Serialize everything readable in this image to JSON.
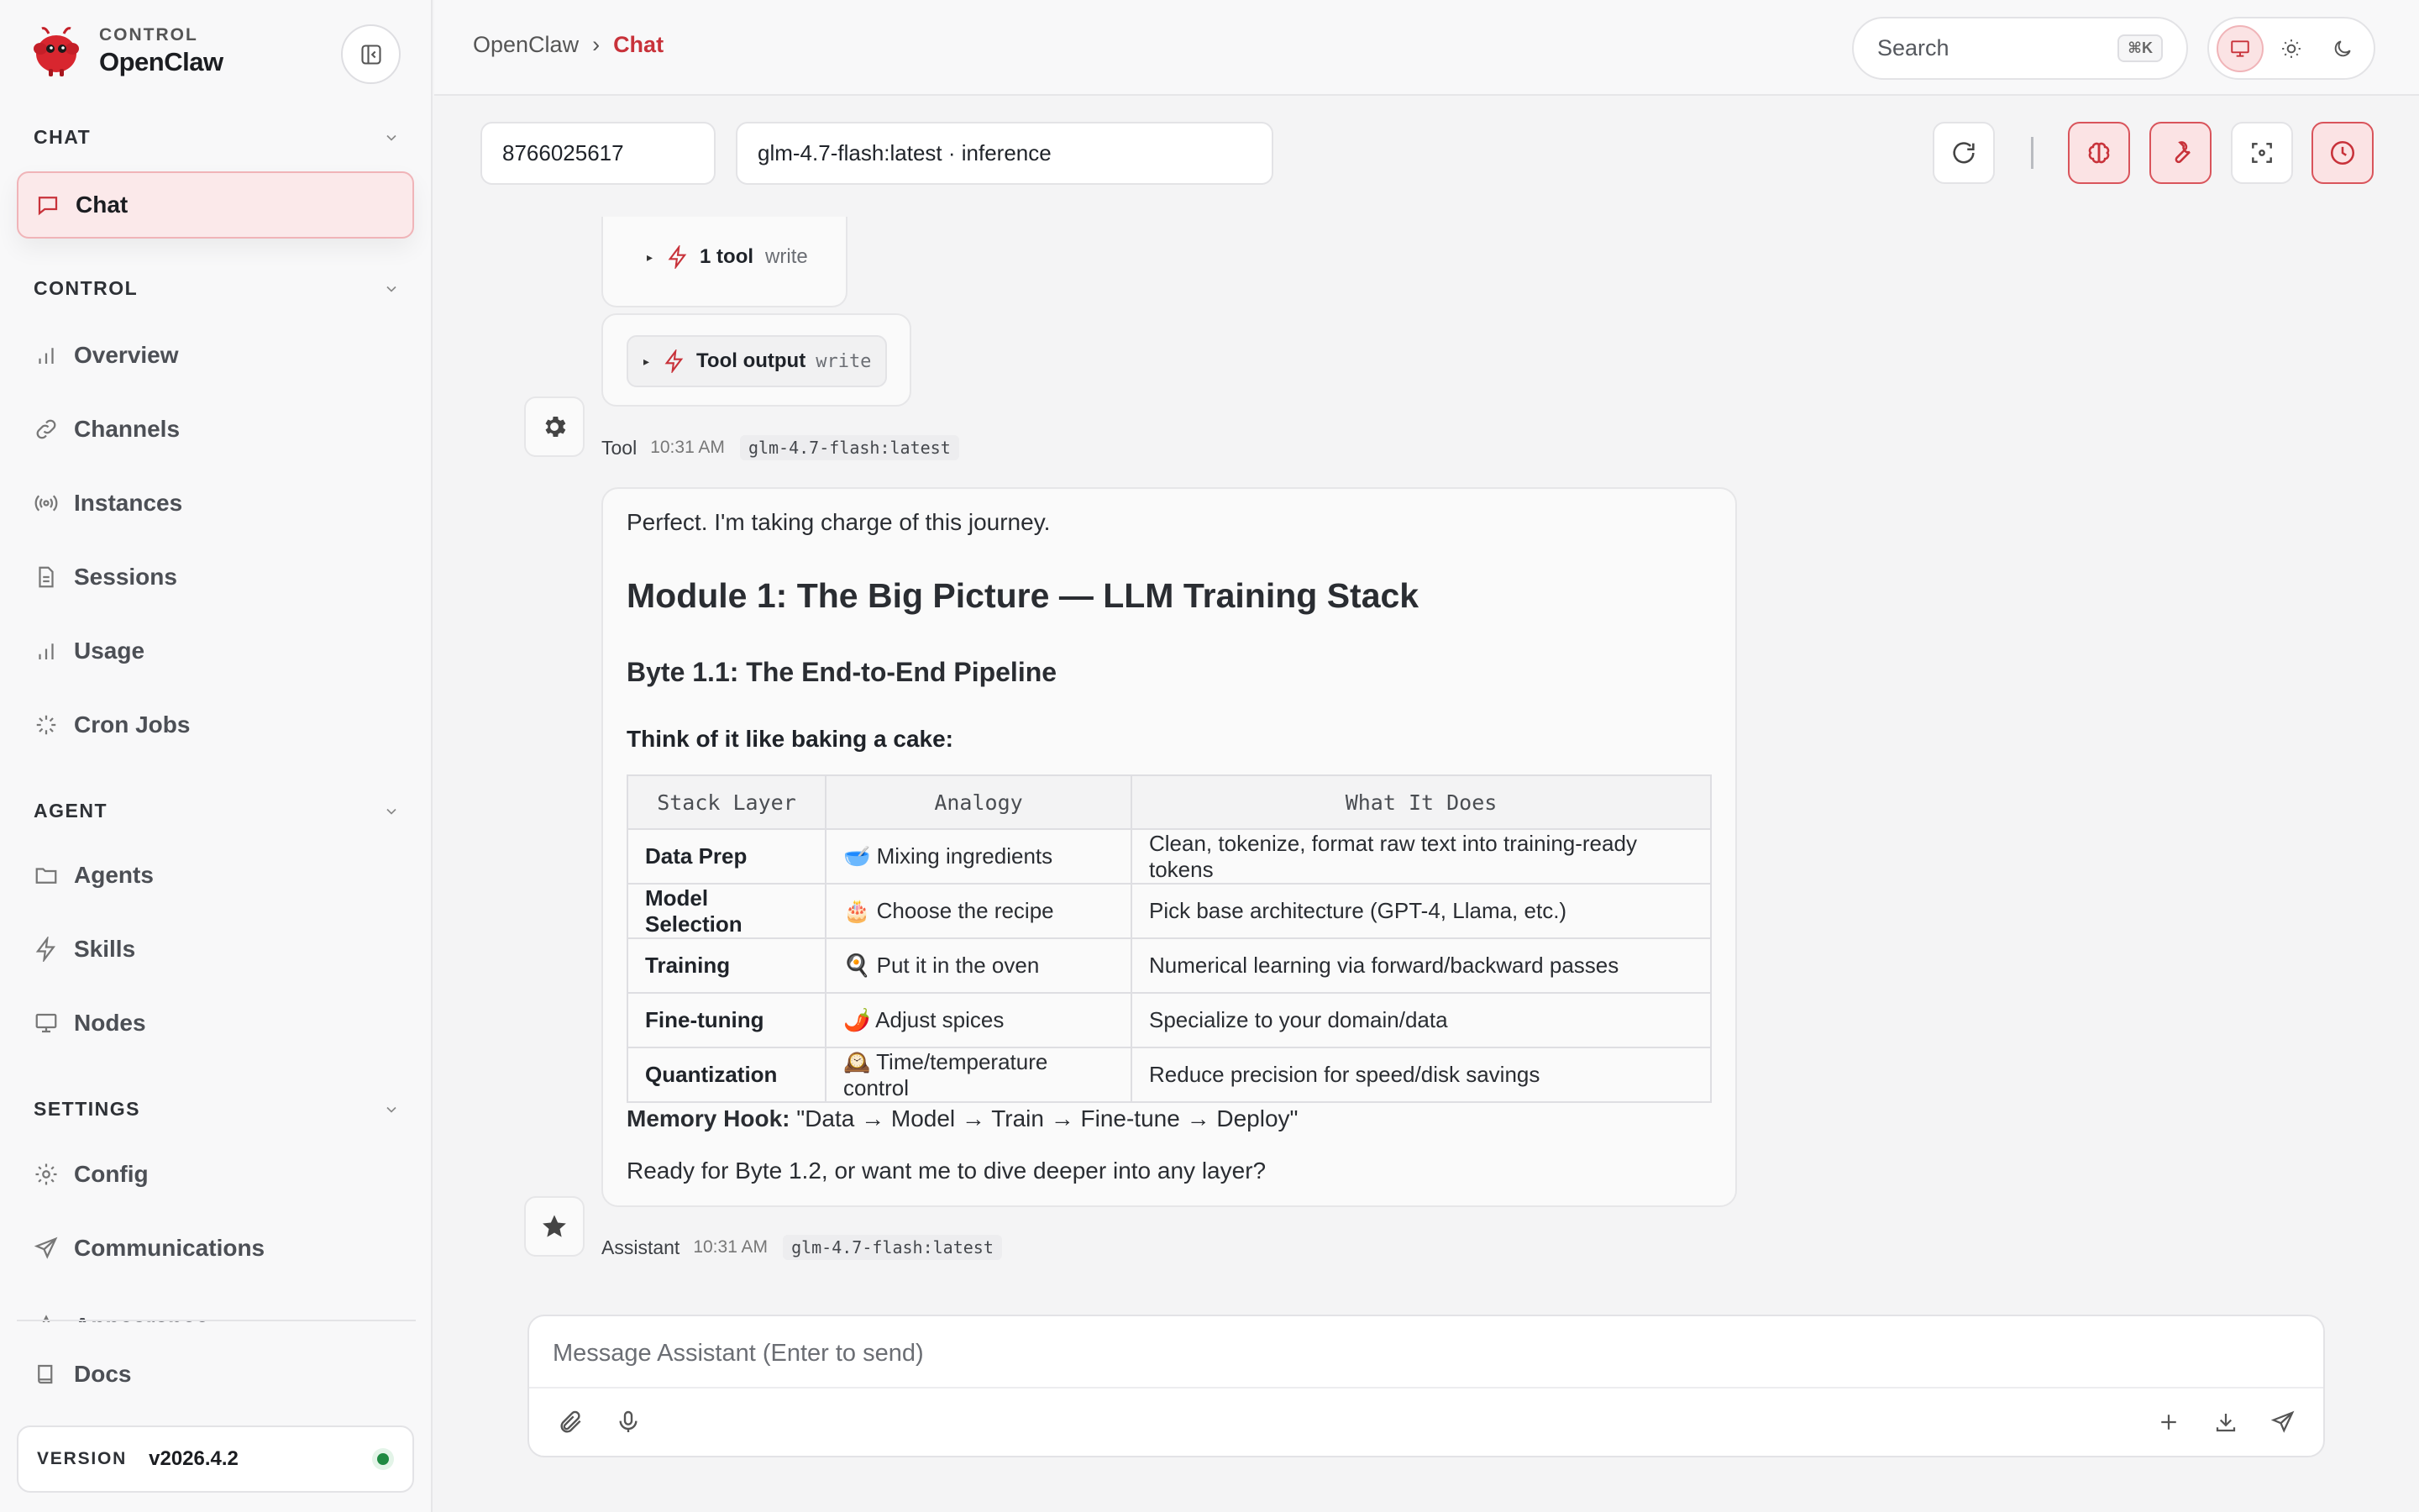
{
  "brand": {
    "sub": "CONTROL",
    "name": "OpenClaw"
  },
  "sidebar": {
    "sections": [
      {
        "title": "CHAT"
      },
      {
        "title": "CONTROL"
      },
      {
        "title": "AGENT"
      },
      {
        "title": "SETTINGS"
      }
    ],
    "active_item": "Chat",
    "items": {
      "overview": "Overview",
      "channels": "Channels",
      "instances": "Instances",
      "sessions": "Sessions",
      "usage": "Usage",
      "cron": "Cron Jobs",
      "agents": "Agents",
      "skills": "Skills",
      "nodes": "Nodes",
      "config": "Config",
      "communications": "Communications",
      "appearance": "Appearance",
      "docs": "Docs"
    },
    "version": {
      "label": "VERSION",
      "value": "v2026.4.2",
      "status_color": "#1f8a42"
    }
  },
  "header": {
    "breadcrumb": {
      "root": "OpenClaw",
      "separator": "›",
      "current": "Chat"
    },
    "search": {
      "placeholder": "Search",
      "shortcut": "⌘K"
    },
    "theme_selected": "system"
  },
  "controls": {
    "session_id": "8766025617",
    "model": "glm-4.7-flash:latest · inference"
  },
  "chat": {
    "tool_call": {
      "count_label": "1 tool",
      "name": "write"
    },
    "tool_output": {
      "label": "Tool output",
      "name": "write"
    },
    "tool_meta": {
      "role": "Tool",
      "time": "10:31 AM",
      "model": "glm-4.7-flash:latest"
    },
    "assistant": {
      "intro": "Perfect. I'm taking charge of this journey.",
      "heading": "Module 1: The Big Picture — LLM Training Stack",
      "subheading": "Byte 1.1: The End-to-End Pipeline",
      "lead": "Think of it like baking a cake:",
      "table": {
        "headers": [
          "Stack Layer",
          "Analogy",
          "What It Does"
        ],
        "rows": [
          [
            "Data Prep",
            "🥣 Mixing ingredients",
            "Clean, tokenize, format raw text into training-ready tokens"
          ],
          [
            "Model Selection",
            "🎂 Choose the recipe",
            "Pick base architecture (GPT-4, Llama, etc.)"
          ],
          [
            "Training",
            "🍳 Put it in the oven",
            "Numerical learning via forward/backward passes"
          ],
          [
            "Fine-tuning",
            "🌶️ Adjust spices",
            "Specialize to your domain/data"
          ],
          [
            "Quantization",
            "🕰️ Time/temperature control",
            "Reduce precision for speed/disk savings"
          ]
        ]
      },
      "hook_label": "Memory Hook:",
      "hook_text": " \"Data → Model → Train → Fine-tune → Deploy\"",
      "question": "Ready for Byte 1.2, or want me to dive deeper into any layer?"
    },
    "assistant_meta": {
      "role": "Assistant",
      "time": "10:31 AM",
      "model": "glm-4.7-flash:latest"
    }
  },
  "composer": {
    "placeholder": "Message Assistant (Enter to send)"
  },
  "colors": {
    "accent": "#c8323a",
    "accent_soft": "#fbe3e4",
    "background": "#f4f4f5"
  }
}
